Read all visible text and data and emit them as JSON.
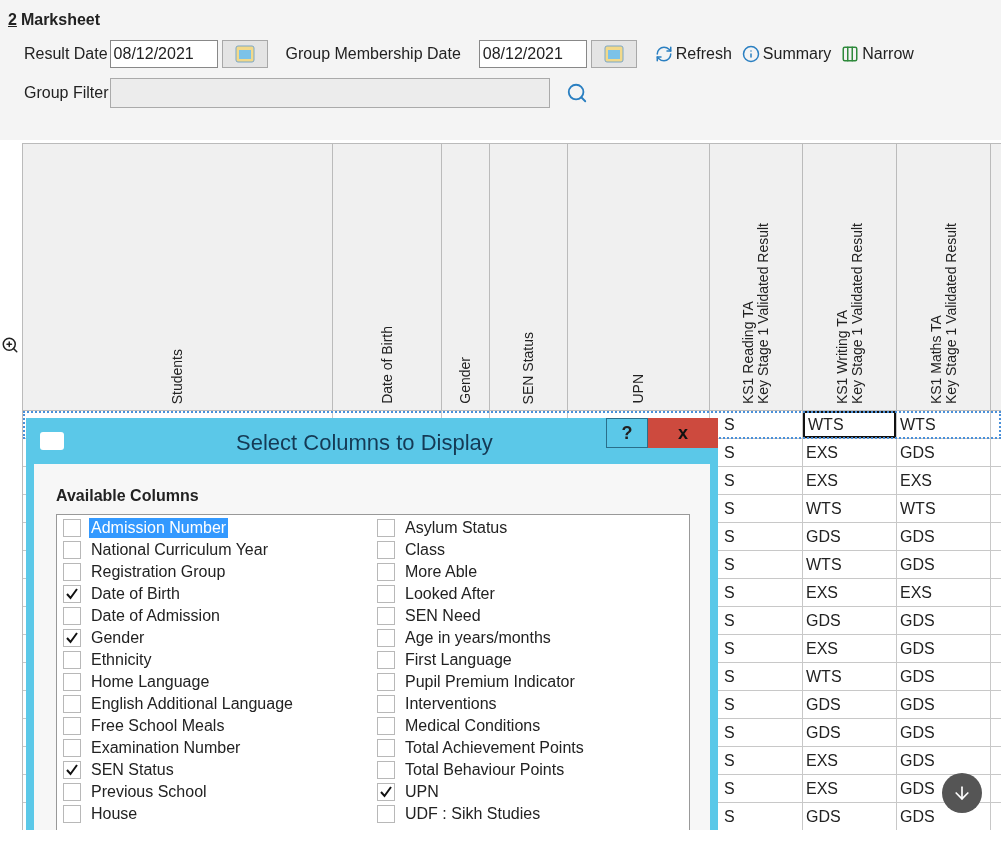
{
  "panel": {
    "number": "2",
    "title": "Marksheet"
  },
  "toolbar": {
    "result_date": {
      "label": "Result Date",
      "value": "08/12/2021"
    },
    "membership_date": {
      "label": "Group Membership Date",
      "value": "08/12/2021"
    },
    "actions": [
      {
        "kind": "refresh",
        "label": "Refresh"
      },
      {
        "kind": "summary",
        "label": "Summary"
      },
      {
        "kind": "narrow",
        "label": "Narrow"
      }
    ]
  },
  "group_filter": {
    "label": "Group Filter",
    "disabled": true
  },
  "table": {
    "columns": [
      {
        "lines": [
          "Students"
        ]
      },
      {
        "lines": [
          "Date of Birth"
        ]
      },
      {
        "lines": [
          "Gender"
        ]
      },
      {
        "lines": [
          "SEN Status"
        ]
      },
      {
        "lines": [
          "UPN"
        ]
      },
      {
        "lines": [
          "KS1 Reading TA",
          "Key Stage 1 Validated Result"
        ]
      },
      {
        "lines": [
          "KS1 Writing TA",
          "Key Stage 1 Validated Result"
        ]
      },
      {
        "lines": [
          "KS1 Maths TA",
          "Key Stage 1 Validated Result"
        ]
      }
    ],
    "rows": [
      {
        "selected": true,
        "cells": [
          {
            "text": "S",
            "focused": false
          },
          {
            "text": "WTS",
            "focused": true
          },
          {
            "text": "WTS",
            "focused": false
          }
        ]
      },
      {
        "selected": false,
        "cells": [
          {
            "text": "S",
            "focused": false
          },
          {
            "text": "EXS",
            "focused": false
          },
          {
            "text": "GDS",
            "focused": false
          }
        ]
      },
      {
        "selected": false,
        "cells": [
          {
            "text": "S",
            "focused": false
          },
          {
            "text": "EXS",
            "focused": false
          },
          {
            "text": "EXS",
            "focused": false
          }
        ]
      },
      {
        "selected": false,
        "cells": [
          {
            "text": "S",
            "focused": false
          },
          {
            "text": "WTS",
            "focused": false
          },
          {
            "text": "WTS",
            "focused": false
          }
        ]
      },
      {
        "selected": false,
        "cells": [
          {
            "text": "S",
            "focused": false
          },
          {
            "text": "GDS",
            "focused": false
          },
          {
            "text": "GDS",
            "focused": false
          }
        ]
      },
      {
        "selected": false,
        "cells": [
          {
            "text": "S",
            "focused": false
          },
          {
            "text": "WTS",
            "focused": false
          },
          {
            "text": "GDS",
            "focused": false
          }
        ]
      },
      {
        "selected": false,
        "cells": [
          {
            "text": "S",
            "focused": false
          },
          {
            "text": "EXS",
            "focused": false
          },
          {
            "text": "EXS",
            "focused": false
          }
        ]
      },
      {
        "selected": false,
        "cells": [
          {
            "text": "S",
            "focused": false
          },
          {
            "text": "GDS",
            "focused": false
          },
          {
            "text": "GDS",
            "focused": false
          }
        ]
      },
      {
        "selected": false,
        "cells": [
          {
            "text": "S",
            "focused": false
          },
          {
            "text": "EXS",
            "focused": false
          },
          {
            "text": "GDS",
            "focused": false
          }
        ]
      },
      {
        "selected": false,
        "cells": [
          {
            "text": "S",
            "focused": false
          },
          {
            "text": "WTS",
            "focused": false
          },
          {
            "text": "GDS",
            "focused": false
          }
        ]
      },
      {
        "selected": false,
        "cells": [
          {
            "text": "S",
            "focused": false
          },
          {
            "text": "GDS",
            "focused": false
          },
          {
            "text": "GDS",
            "focused": false
          }
        ]
      },
      {
        "selected": false,
        "cells": [
          {
            "text": "S",
            "focused": false
          },
          {
            "text": "GDS",
            "focused": false
          },
          {
            "text": "GDS",
            "focused": false
          }
        ]
      },
      {
        "selected": false,
        "cells": [
          {
            "text": "S",
            "focused": false
          },
          {
            "text": "EXS",
            "focused": false
          },
          {
            "text": "GDS",
            "focused": false
          }
        ]
      },
      {
        "selected": false,
        "cells": [
          {
            "text": "S",
            "focused": false
          },
          {
            "text": "EXS",
            "focused": false
          },
          {
            "text": "GDS",
            "focused": false
          }
        ]
      },
      {
        "selected": false,
        "cells": [
          {
            "text": "S",
            "focused": false
          },
          {
            "text": "GDS",
            "focused": false
          },
          {
            "text": "GDS",
            "focused": false
          }
        ]
      }
    ]
  },
  "dialog": {
    "title": "Select Columns to Display",
    "help": "?",
    "close": "x",
    "section": "Available Columns",
    "left": [
      {
        "label": "Admission Number",
        "checked": false,
        "selected": true
      },
      {
        "label": "National Curriculum Year",
        "checked": false,
        "selected": false
      },
      {
        "label": "Registration Group",
        "checked": false,
        "selected": false
      },
      {
        "label": "Date of Birth",
        "checked": true,
        "selected": false
      },
      {
        "label": "Date of Admission",
        "checked": false,
        "selected": false
      },
      {
        "label": "Gender",
        "checked": true,
        "selected": false
      },
      {
        "label": "Ethnicity",
        "checked": false,
        "selected": false
      },
      {
        "label": "Home Language",
        "checked": false,
        "selected": false
      },
      {
        "label": "English Additional Language",
        "checked": false,
        "selected": false
      },
      {
        "label": "Free School Meals",
        "checked": false,
        "selected": false
      },
      {
        "label": "Examination Number",
        "checked": false,
        "selected": false
      },
      {
        "label": "SEN Status",
        "checked": true,
        "selected": false
      },
      {
        "label": "Previous School",
        "checked": false,
        "selected": false
      },
      {
        "label": "House",
        "checked": false,
        "selected": false
      }
    ],
    "right": [
      {
        "label": "Asylum Status",
        "checked": false,
        "selected": false
      },
      {
        "label": "Class",
        "checked": false,
        "selected": false
      },
      {
        "label": "More Able",
        "checked": false,
        "selected": false
      },
      {
        "label": "Looked After",
        "checked": false,
        "selected": false
      },
      {
        "label": "SEN Need",
        "checked": false,
        "selected": false
      },
      {
        "label": "Age in years/months",
        "checked": false,
        "selected": false
      },
      {
        "label": "First Language",
        "checked": false,
        "selected": false
      },
      {
        "label": "Pupil Premium Indicator",
        "checked": false,
        "selected": false
      },
      {
        "label": "Interventions",
        "checked": false,
        "selected": false
      },
      {
        "label": "Medical Conditions",
        "checked": false,
        "selected": false
      },
      {
        "label": "Total Achievement Points",
        "checked": false,
        "selected": false
      },
      {
        "label": "Total Behaviour Points",
        "checked": false,
        "selected": false
      },
      {
        "label": "UPN",
        "checked": true,
        "selected": false
      },
      {
        "label": "UDF : Sikh Studies",
        "checked": false,
        "selected": false
      }
    ]
  }
}
